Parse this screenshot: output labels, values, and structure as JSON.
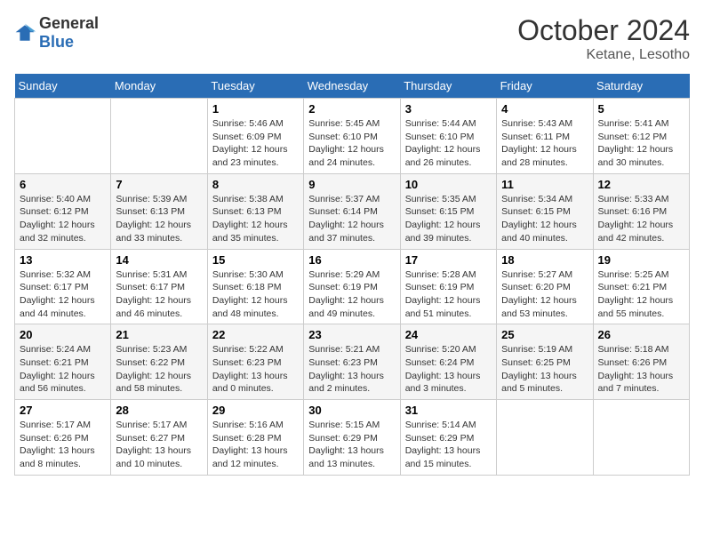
{
  "header": {
    "logo": {
      "general": "General",
      "blue": "Blue"
    },
    "month": "October 2024",
    "location": "Ketane, Lesotho"
  },
  "weekdays": [
    "Sunday",
    "Monday",
    "Tuesday",
    "Wednesday",
    "Thursday",
    "Friday",
    "Saturday"
  ],
  "weeks": [
    [
      {
        "day": "",
        "info": ""
      },
      {
        "day": "",
        "info": ""
      },
      {
        "day": "1",
        "info": "Sunrise: 5:46 AM\nSunset: 6:09 PM\nDaylight: 12 hours and 23 minutes."
      },
      {
        "day": "2",
        "info": "Sunrise: 5:45 AM\nSunset: 6:10 PM\nDaylight: 12 hours and 24 minutes."
      },
      {
        "day": "3",
        "info": "Sunrise: 5:44 AM\nSunset: 6:10 PM\nDaylight: 12 hours and 26 minutes."
      },
      {
        "day": "4",
        "info": "Sunrise: 5:43 AM\nSunset: 6:11 PM\nDaylight: 12 hours and 28 minutes."
      },
      {
        "day": "5",
        "info": "Sunrise: 5:41 AM\nSunset: 6:12 PM\nDaylight: 12 hours and 30 minutes."
      }
    ],
    [
      {
        "day": "6",
        "info": "Sunrise: 5:40 AM\nSunset: 6:12 PM\nDaylight: 12 hours and 32 minutes."
      },
      {
        "day": "7",
        "info": "Sunrise: 5:39 AM\nSunset: 6:13 PM\nDaylight: 12 hours and 33 minutes."
      },
      {
        "day": "8",
        "info": "Sunrise: 5:38 AM\nSunset: 6:13 PM\nDaylight: 12 hours and 35 minutes."
      },
      {
        "day": "9",
        "info": "Sunrise: 5:37 AM\nSunset: 6:14 PM\nDaylight: 12 hours and 37 minutes."
      },
      {
        "day": "10",
        "info": "Sunrise: 5:35 AM\nSunset: 6:15 PM\nDaylight: 12 hours and 39 minutes."
      },
      {
        "day": "11",
        "info": "Sunrise: 5:34 AM\nSunset: 6:15 PM\nDaylight: 12 hours and 40 minutes."
      },
      {
        "day": "12",
        "info": "Sunrise: 5:33 AM\nSunset: 6:16 PM\nDaylight: 12 hours and 42 minutes."
      }
    ],
    [
      {
        "day": "13",
        "info": "Sunrise: 5:32 AM\nSunset: 6:17 PM\nDaylight: 12 hours and 44 minutes."
      },
      {
        "day": "14",
        "info": "Sunrise: 5:31 AM\nSunset: 6:17 PM\nDaylight: 12 hours and 46 minutes."
      },
      {
        "day": "15",
        "info": "Sunrise: 5:30 AM\nSunset: 6:18 PM\nDaylight: 12 hours and 48 minutes."
      },
      {
        "day": "16",
        "info": "Sunrise: 5:29 AM\nSunset: 6:19 PM\nDaylight: 12 hours and 49 minutes."
      },
      {
        "day": "17",
        "info": "Sunrise: 5:28 AM\nSunset: 6:19 PM\nDaylight: 12 hours and 51 minutes."
      },
      {
        "day": "18",
        "info": "Sunrise: 5:27 AM\nSunset: 6:20 PM\nDaylight: 12 hours and 53 minutes."
      },
      {
        "day": "19",
        "info": "Sunrise: 5:25 AM\nSunset: 6:21 PM\nDaylight: 12 hours and 55 minutes."
      }
    ],
    [
      {
        "day": "20",
        "info": "Sunrise: 5:24 AM\nSunset: 6:21 PM\nDaylight: 12 hours and 56 minutes."
      },
      {
        "day": "21",
        "info": "Sunrise: 5:23 AM\nSunset: 6:22 PM\nDaylight: 12 hours and 58 minutes."
      },
      {
        "day": "22",
        "info": "Sunrise: 5:22 AM\nSunset: 6:23 PM\nDaylight: 13 hours and 0 minutes."
      },
      {
        "day": "23",
        "info": "Sunrise: 5:21 AM\nSunset: 6:23 PM\nDaylight: 13 hours and 2 minutes."
      },
      {
        "day": "24",
        "info": "Sunrise: 5:20 AM\nSunset: 6:24 PM\nDaylight: 13 hours and 3 minutes."
      },
      {
        "day": "25",
        "info": "Sunrise: 5:19 AM\nSunset: 6:25 PM\nDaylight: 13 hours and 5 minutes."
      },
      {
        "day": "26",
        "info": "Sunrise: 5:18 AM\nSunset: 6:26 PM\nDaylight: 13 hours and 7 minutes."
      }
    ],
    [
      {
        "day": "27",
        "info": "Sunrise: 5:17 AM\nSunset: 6:26 PM\nDaylight: 13 hours and 8 minutes."
      },
      {
        "day": "28",
        "info": "Sunrise: 5:17 AM\nSunset: 6:27 PM\nDaylight: 13 hours and 10 minutes."
      },
      {
        "day": "29",
        "info": "Sunrise: 5:16 AM\nSunset: 6:28 PM\nDaylight: 13 hours and 12 minutes."
      },
      {
        "day": "30",
        "info": "Sunrise: 5:15 AM\nSunset: 6:29 PM\nDaylight: 13 hours and 13 minutes."
      },
      {
        "day": "31",
        "info": "Sunrise: 5:14 AM\nSunset: 6:29 PM\nDaylight: 13 hours and 15 minutes."
      },
      {
        "day": "",
        "info": ""
      },
      {
        "day": "",
        "info": ""
      }
    ]
  ]
}
